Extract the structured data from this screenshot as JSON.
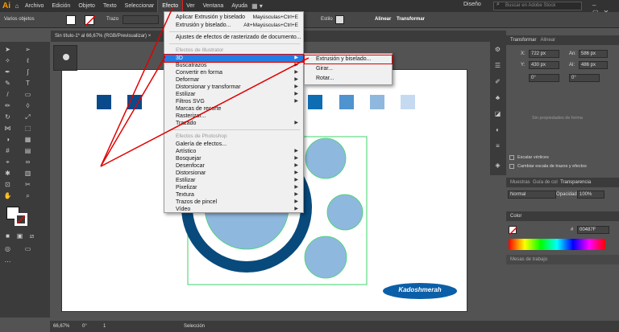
{
  "menubar": {
    "logo": "Ai",
    "items": [
      "Archivo",
      "Edición",
      "Objeto",
      "Texto",
      "Seleccionar",
      "Efecto",
      "Ver",
      "Ventana",
      "Ayuda"
    ],
    "workspace": "Diseño",
    "search_placeholder": "Buscar en Adobe Stock"
  },
  "optbar": {
    "selection": "Varios objetos",
    "stroke_label": "Trazo",
    "style_label": "Estilo",
    "align_label": "Alinear",
    "transform_label": "Transformar"
  },
  "doc": {
    "tab_title": "Sin título-1* al 66,67% (RGB/Previsualizar)",
    "close": "×"
  },
  "menu": {
    "apply": "Aplicar Extrusión y biselado",
    "apply_shortcut": "Mayúsculas+Ctrl+E",
    "extrude": "Extrusión y biselado...",
    "extrude_shortcut": "Alt+Mayúsculas+Ctrl+E",
    "raster_settings": "Ajustes de efectos de rasterizado de documento...",
    "section_illustrator": "Efectos de Illustrator",
    "illustrator_items": [
      "3D",
      "Buscatrazos",
      "Convertir en forma",
      "Deformar",
      "Distorsionar y transformar",
      "Estilizar",
      "Filtros SVG",
      "Marcas de recorte",
      "Rasterizar...",
      "Trazado"
    ],
    "section_photoshop": "Efectos de Photoshop",
    "photoshop_items": [
      "Galería de efectos...",
      "Artístico",
      "Bosquejar",
      "Desenfocar",
      "Distorsionar",
      "Estilizar",
      "Pixelizar",
      "Textura",
      "Trazos de pincel",
      "Vídeo"
    ]
  },
  "submenu": {
    "items": [
      "Extrusión y biselado...",
      "Girar...",
      "Rotar..."
    ]
  },
  "panel_transform": {
    "tab1": "Transformar",
    "tab2": "Alinear",
    "x_label": "X:",
    "x": "722 px",
    "w_label": "An:",
    "w": "586 px",
    "y_label": "Y:",
    "y": "430 px",
    "h_label": "Al:",
    "h": "486 px",
    "angle1": "0°",
    "angle2": "0°",
    "no_props": "Sin propiedades de forma",
    "scale_corners": "Escalar vértices",
    "scale_strokes": "Cambiar escala de trazos y efectos"
  },
  "panel_transparency": {
    "tabs": [
      "Muestras",
      "Guía de col",
      "Transparencia"
    ],
    "mode": "Normal",
    "opacity_label": "Opacidad:",
    "opacity": "100%"
  },
  "panel_color": {
    "title": "Color",
    "hash": "#",
    "hex": "00487F"
  },
  "panel_areas": {
    "title": "Mesas de trabajo"
  },
  "statusbar": {
    "zoom": "66,67%",
    "angle": "0°",
    "page": "1",
    "mode": "Selección"
  },
  "artwork": {
    "badge": "Kadoshmerah"
  },
  "colors": {
    "blue_dark": "#0b4a8a",
    "blue_mid": "#0d6db3",
    "blue_light": "#8fb8de",
    "blue_pale": "#c5daf0",
    "ring": "#084a7c",
    "red": "#e00000",
    "badge": "#0b5fa8",
    "selection": "#3cd66a"
  }
}
